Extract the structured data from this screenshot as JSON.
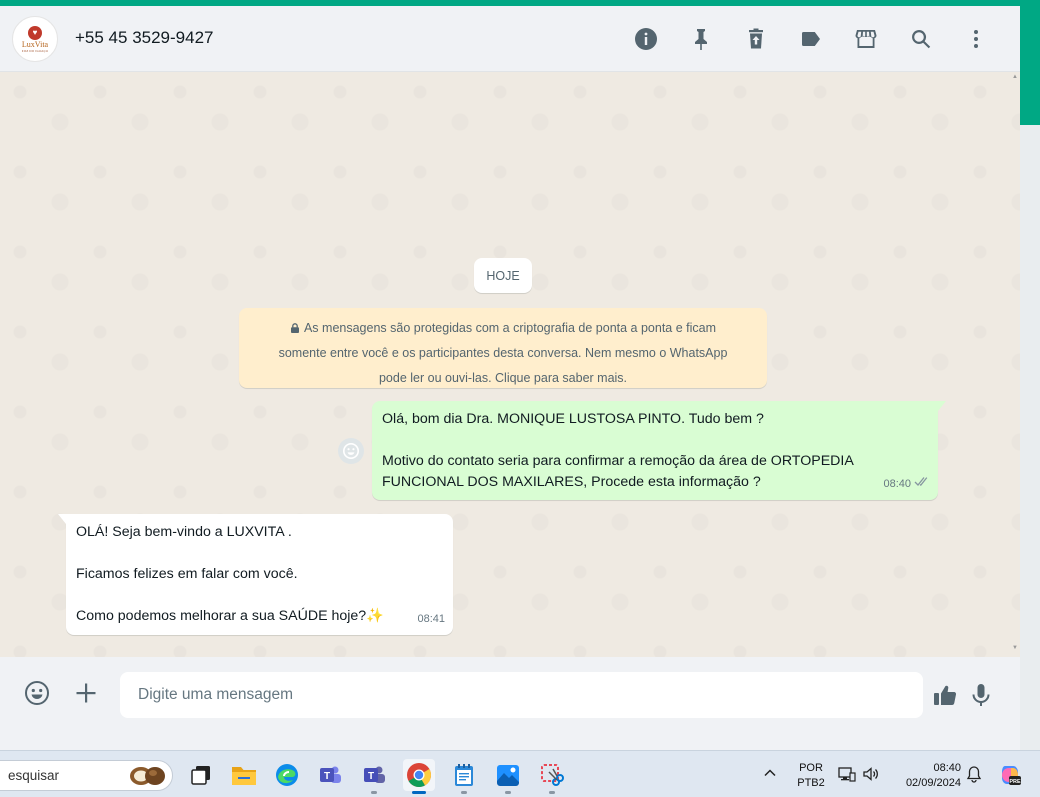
{
  "header": {
    "avatar_brand": "LuxVita",
    "avatar_sub": "FOZ DO IGUAÇU",
    "contact_name": "+55 45 3529-9427",
    "icons": [
      "info-icon",
      "pin-icon",
      "delete-icon",
      "label-icon",
      "store-icon",
      "search-icon",
      "more-icon"
    ]
  },
  "chat": {
    "date_chip": "HOJE",
    "encryption_notice": {
      "line1": "As mensagens são protegidas com a criptografia de ponta a ponta e ficam",
      "line2": "somente entre você e os participantes desta conversa. Nem mesmo o WhatsApp",
      "line3": "pode ler ou ouvi-las. Clique para saber mais."
    },
    "outgoing": {
      "line1": "Olá, bom dia Dra. MONIQUE LUSTOSA PINTO. Tudo bem ?",
      "line2": "Motivo do contato seria para confirmar a remoção da área de ORTOPEDIA",
      "line3": "FUNCIONAL DOS MAXILARES, Procede esta informação ?",
      "time": "08:40",
      "status": "read"
    },
    "incoming": {
      "line1": "OLÁ! Seja bem-vindo a  LUXVITA .",
      "line2": "Ficamos felizes em falar com você.",
      "line3": "Como podemos melhorar a sua SAÚDE hoje?✨",
      "time": "08:41"
    }
  },
  "composer": {
    "placeholder": "Digite uma mensagem",
    "value": ""
  },
  "taskbar": {
    "search_placeholder": "esquisar",
    "apps": [
      "task-view",
      "file-explorer",
      "edge",
      "teams-classic",
      "teams",
      "chrome",
      "notepad",
      "photos",
      "snipping-tool"
    ],
    "active_app": "chrome",
    "lang_line1": "POR",
    "lang_line2": "PTB2",
    "time": "08:40",
    "date": "02/09/2024",
    "colors": {
      "accent": "#00a884",
      "taskbar": "#dfe7f1",
      "outgoing_bubble": "#d9fdd3"
    }
  }
}
